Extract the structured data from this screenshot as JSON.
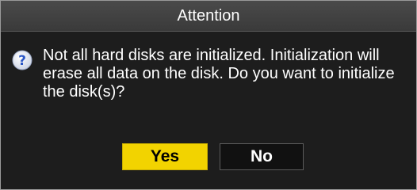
{
  "dialog": {
    "title": "Attention",
    "icon": "question-icon",
    "message": "Not all hard disks are initialized. Initialization will erase all data on the disk. Do you want to initialize the disk(s)?",
    "buttons": {
      "yes": "Yes",
      "no": "No"
    }
  },
  "colors": {
    "title_bar": "#3f3f3f",
    "background": "#1d1d1d",
    "accent_yellow": "#f2d300",
    "icon_blue": "#2a56c6"
  }
}
